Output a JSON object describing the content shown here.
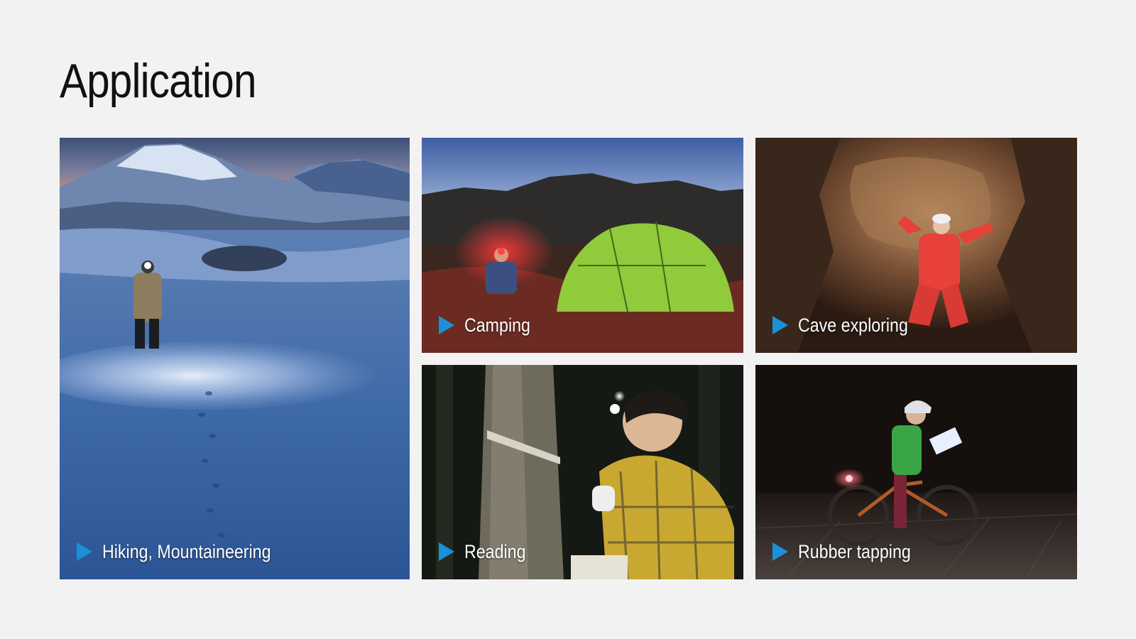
{
  "page": {
    "title": "Application"
  },
  "tiles": [
    {
      "id": "hiking",
      "label": "Hiking, Mountaineering",
      "icon": "play-triangle-icon"
    },
    {
      "id": "camping",
      "label": "Camping",
      "icon": "play-triangle-icon"
    },
    {
      "id": "cave",
      "label": "Cave exploring",
      "icon": "play-triangle-icon"
    },
    {
      "id": "reading",
      "label": "Reading",
      "icon": "play-triangle-icon"
    },
    {
      "id": "rubber",
      "label": "Rubber tapping",
      "icon": "play-triangle-icon"
    }
  ],
  "colors": {
    "background": "#f2f2f2",
    "title": "#111111",
    "accent": "#1a90d9",
    "caption_text": "#ffffff"
  }
}
